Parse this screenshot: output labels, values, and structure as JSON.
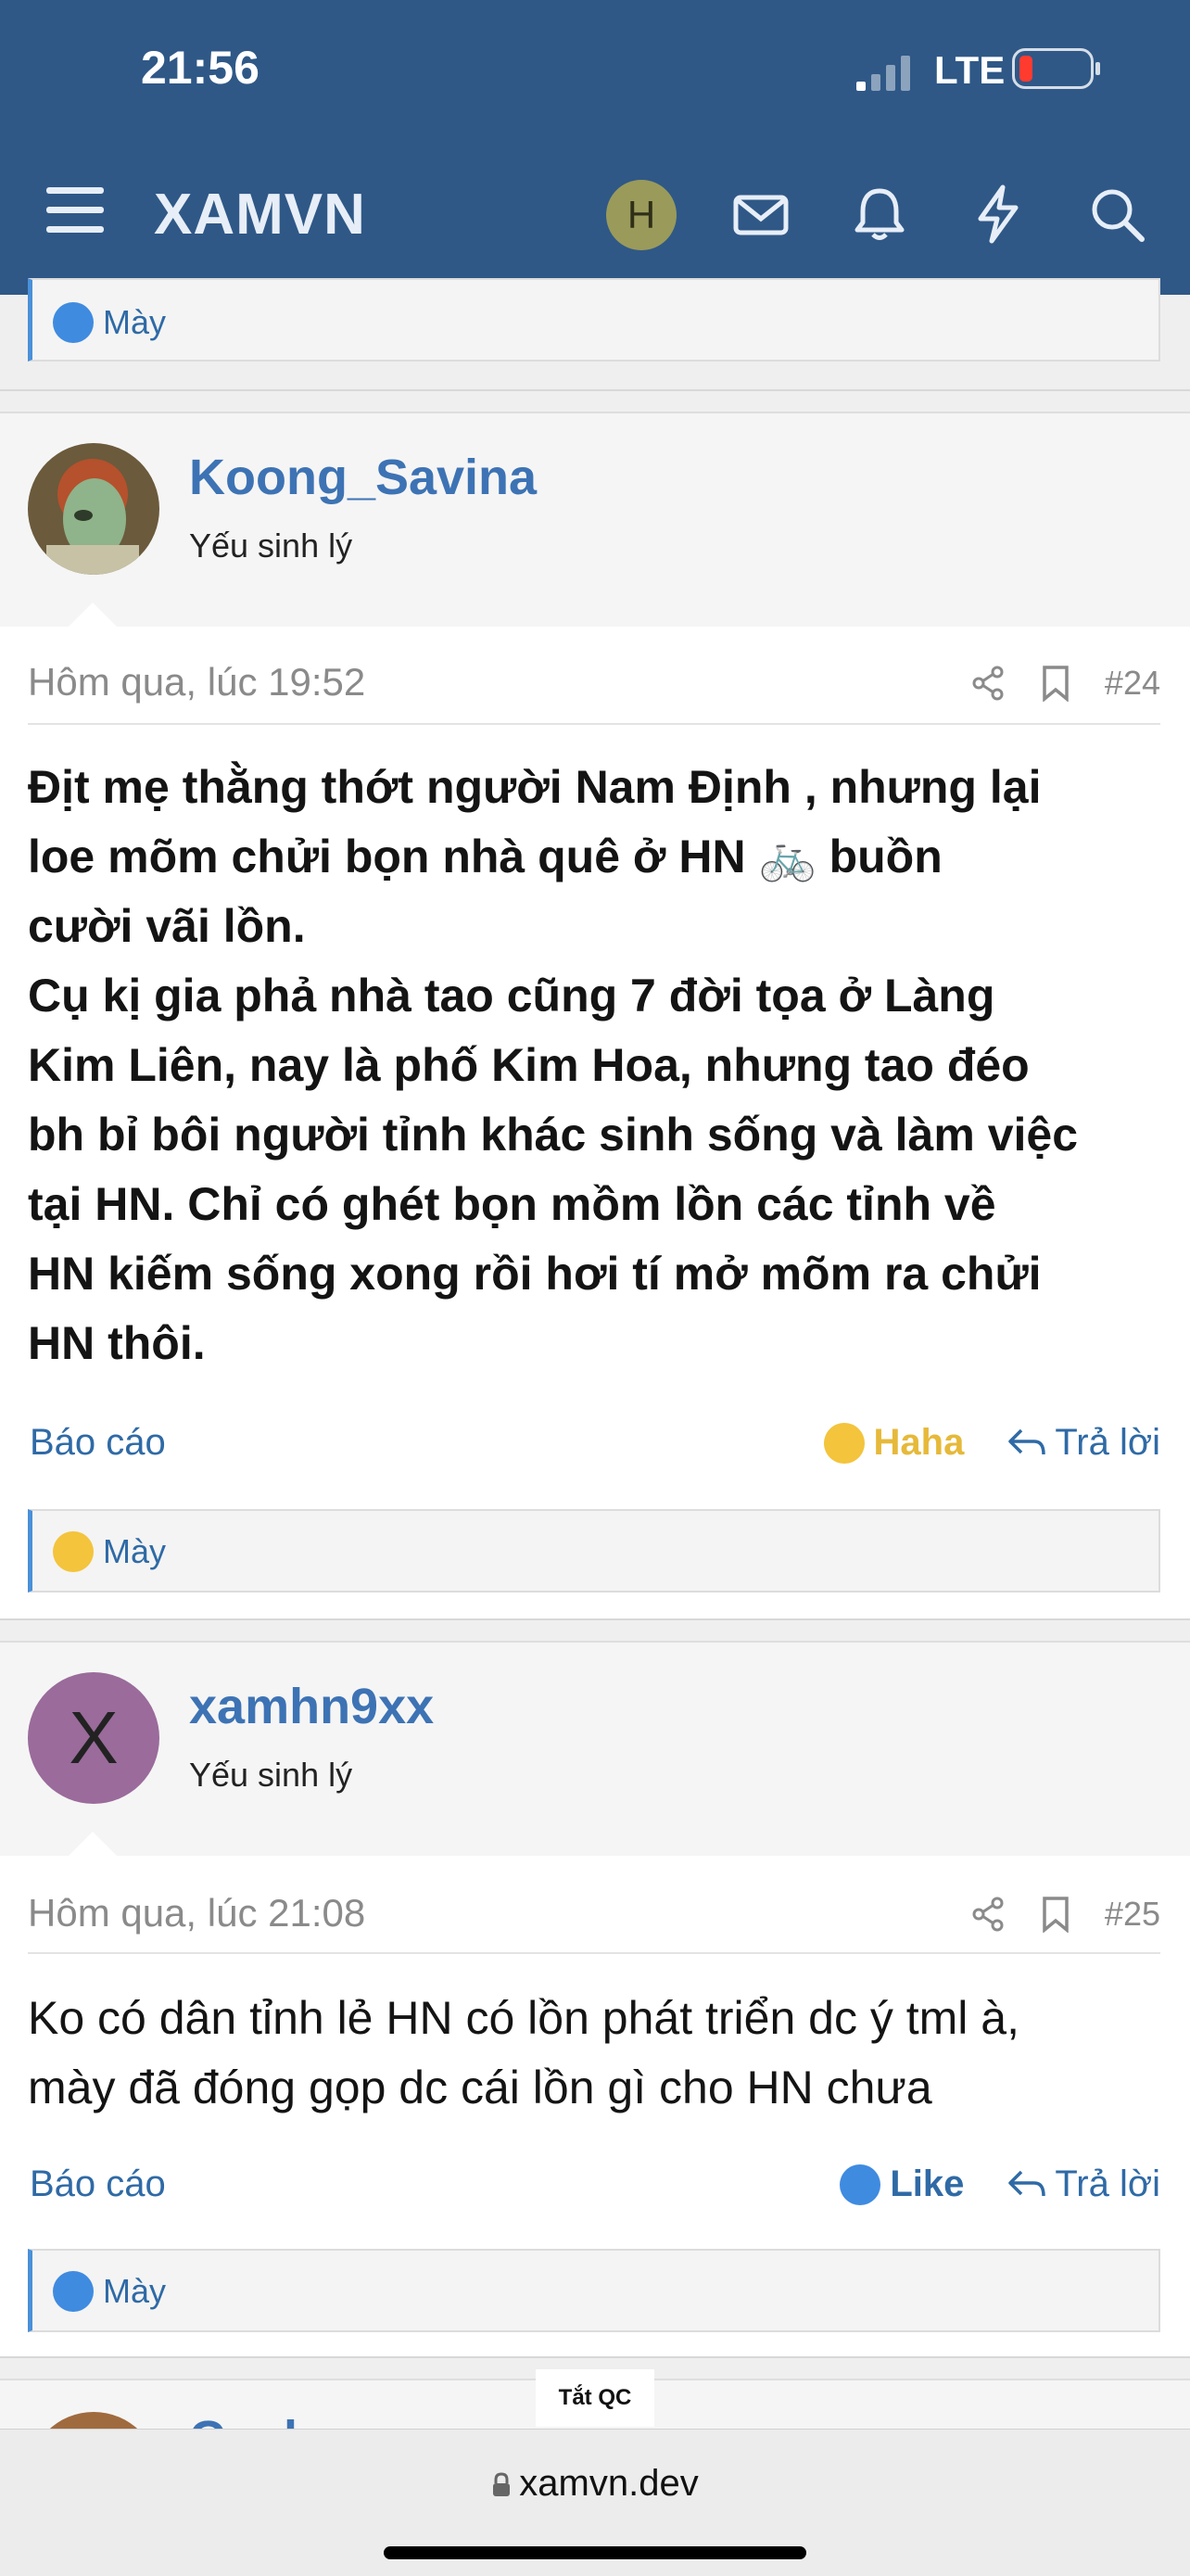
{
  "status_bar": {
    "time": "21:56",
    "network": "LTE"
  },
  "header": {
    "brand": "XAMVN",
    "avatar_letter": "H"
  },
  "top_quote": {
    "reaction": "Mày"
  },
  "posts": [
    {
      "username": "Koong_Savina",
      "role": "Yếu sinh lý",
      "time": "Hôm qua, lúc 19:52",
      "number": "#24",
      "lines": [
        "Địt mẹ thằng thớt người Nam Định , nhưng lại",
        "loe mõm chửi bọn nhà quê ở HN 🚲 buồn",
        "cười vãi lồn.",
        "Cụ kị gia phả nhà tao cũng 7 đời tọa ở Làng",
        "Kim Liên, nay là phố Kim Hoa, nhưng tao đéo",
        "bh bỉ bôi người tỉnh khác sinh sống và làm việc",
        "tại HN. Chỉ có ghét bọn mồm lồn các tỉnh về",
        "HN kiếm sống xong rồi hơi tí mở mõm ra chửi",
        "HN thôi."
      ],
      "report_label": "Báo cáo",
      "reaction_label": "Haha",
      "reaction_color": "#e6b93a",
      "reply_label": "Trả lời",
      "reactor": "Mày"
    },
    {
      "username": "xamhn9xx",
      "avatar_letter": "X",
      "role": "Yếu sinh lý",
      "time": "Hôm qua, lúc 21:08",
      "number": "#25",
      "lines": [
        "Ko có dân tỉnh lẻ HN có lồn phát triển dc ý tml à,",
        "mày đã đóng gọp dc cái lồn gì cho HN chưa"
      ],
      "report_label": "Báo cáo",
      "reaction_label": "Like",
      "reaction_color": "#2f6aa6",
      "reply_label": "Trả lời",
      "reactor": "Mày"
    }
  ],
  "next_post_username_partial": "Co_h",
  "ad_label": "Tắt QC",
  "browser": {
    "url": "xamvn.dev"
  },
  "colors": {
    "header_bg": "#2f5887",
    "link_blue": "#3d73b4"
  },
  "icons": [
    "menu-icon",
    "mail-icon",
    "bell-icon",
    "bolt-icon",
    "search-icon",
    "share-icon",
    "bookmark-icon",
    "like-icon",
    "haha-icon",
    "reply-icon",
    "lock-icon"
  ]
}
